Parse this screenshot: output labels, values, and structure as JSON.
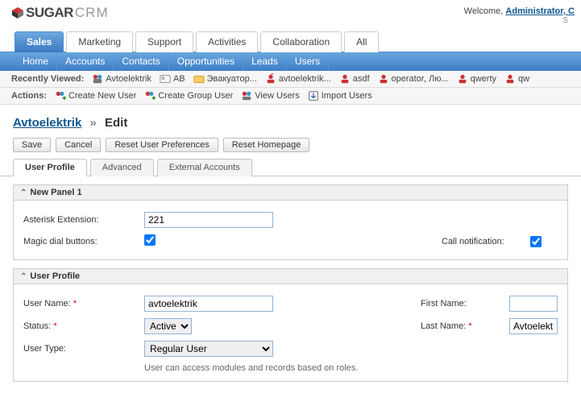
{
  "header": {
    "logo_brand": "SUGAR",
    "logo_suffix": "CRM",
    "welcome_prefix": "Welcome, ",
    "welcome_user": "Administrator, C",
    "welcome_sub": "S"
  },
  "main_tabs": [
    "Sales",
    "Marketing",
    "Support",
    "Activities",
    "Collaboration",
    "All"
  ],
  "main_tab_active": 0,
  "sub_tabs": [
    "Home",
    "Accounts",
    "Contacts",
    "Opportunities",
    "Leads",
    "Users"
  ],
  "recently_viewed": {
    "label": "Recently Viewed:",
    "items": [
      "Avtoelektrik",
      "АВ",
      "Эвакуатор...",
      "avtoelektrik...",
      "asdf",
      "operator, Лю...",
      "qwerty",
      "qw"
    ]
  },
  "actions": {
    "label": "Actions:",
    "items": [
      "Create New User",
      "Create Group User",
      "View Users",
      "Import Users"
    ]
  },
  "breadcrumb": {
    "link": "Avtoelektrik",
    "sep": "»",
    "current": "Edit"
  },
  "buttons": {
    "save": "Save",
    "cancel": "Cancel",
    "reset_prefs": "Reset User Preferences",
    "reset_home": "Reset Homepage"
  },
  "form_tabs": [
    "User Profile",
    "Advanced",
    "External Accounts"
  ],
  "panel1": {
    "title": "New Panel 1",
    "ext_label": "Asterisk Extension:",
    "ext_value": "221",
    "magic_label": "Magic dial buttons:",
    "magic_checked": true,
    "notif_label": "Call notification:",
    "notif_checked": true
  },
  "panel2": {
    "title": "User Profile",
    "username_label": "User Name:",
    "username_value": "avtoelektrik",
    "firstname_label": "First Name:",
    "firstname_value": "",
    "status_label": "Status:",
    "status_value": "Active",
    "lastname_label": "Last Name:",
    "lastname_value": "Avtoelektril",
    "usertype_label": "User Type:",
    "usertype_value": "Regular User",
    "usertype_hint": "User can access modules and records based on roles."
  }
}
